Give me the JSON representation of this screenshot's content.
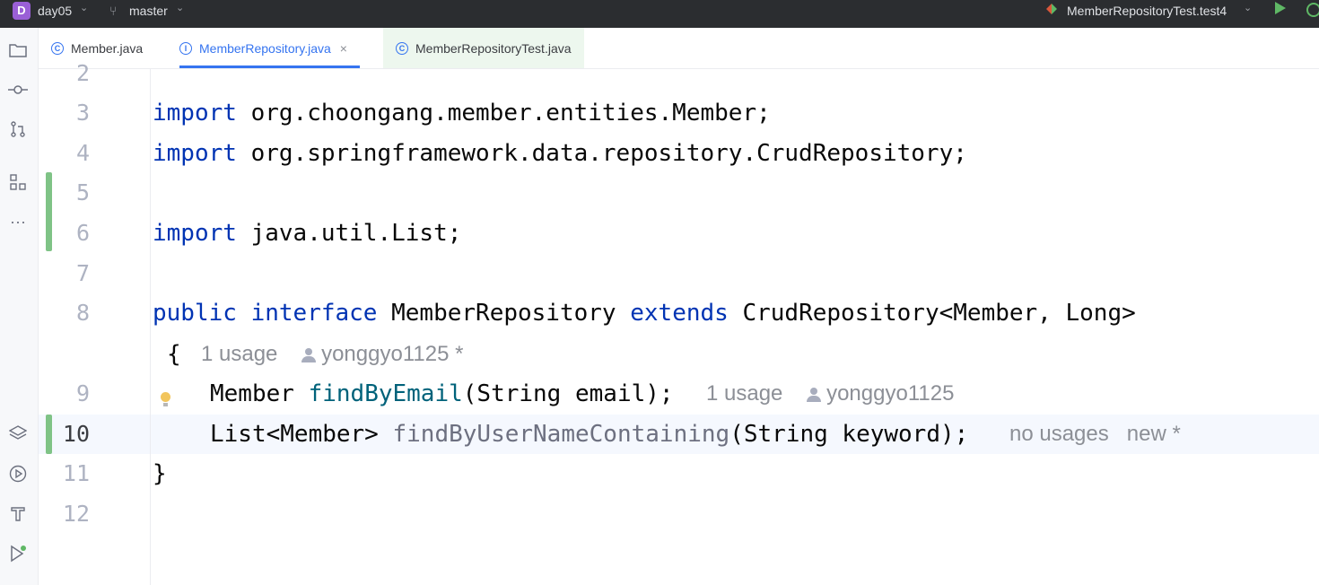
{
  "titlebar": {
    "project_initial": "D",
    "project_name": "day05",
    "branch": "master",
    "run_config": "MemberRepositoryTest.test4"
  },
  "tabs": [
    {
      "label": "Member.java",
      "icon": "class-icon"
    },
    {
      "label": "MemberRepository.java",
      "icon": "interface-icon",
      "close": "×"
    },
    {
      "label": "MemberRepositoryTest.java",
      "icon": "test-class-icon"
    }
  ],
  "editor": {
    "lines": [
      {
        "num": "2"
      },
      {
        "num": "3"
      },
      {
        "num": "4"
      },
      {
        "num": "5"
      },
      {
        "num": "6"
      },
      {
        "num": "7"
      },
      {
        "num": "8"
      },
      {
        "num": "9"
      },
      {
        "num": "10"
      },
      {
        "num": "11"
      },
      {
        "num": "12"
      }
    ],
    "code": {
      "l3_kw": "import",
      "l3_rest": " org.choongang.member.entities.Member;",
      "l4_kw": "import",
      "l4_rest": " org.springframework.data.repository.CrudRepository;",
      "l6_kw": "import",
      "l6_rest": " java.util.List;",
      "l8_kw1": "public",
      "l8_kw2": "interface",
      "l8_name": " MemberRepository ",
      "l8_kw3": "extends",
      "l8_rest": " CrudRepository<Member, Long>",
      "l8_brace": "{",
      "l8_usage": "1 usage",
      "l8_author": "yonggyo1125 *",
      "l9_type": "Member ",
      "l9_method": "findByEmail",
      "l9_rest": "(String email);",
      "l9_usage": "1 usage",
      "l9_author": "yonggyo1125",
      "l10_type": "List<Member> ",
      "l10_method": "findByUserNameContaining",
      "l10_rest": "(String keyword);",
      "l10_usage": "no usages",
      "l10_new": "new *",
      "l11_brace": "}"
    }
  }
}
